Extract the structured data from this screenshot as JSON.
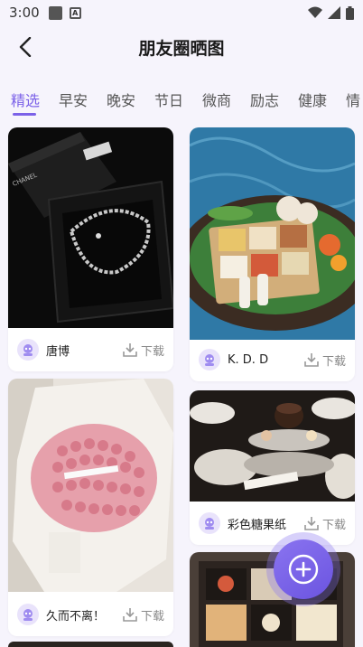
{
  "status": {
    "time": "3:00"
  },
  "header": {
    "title": "朋友圈晒图"
  },
  "tabs": [
    {
      "label": "精选",
      "active": true
    },
    {
      "label": "早安"
    },
    {
      "label": "晚安"
    },
    {
      "label": "节日"
    },
    {
      "label": "微商"
    },
    {
      "label": "励志"
    },
    {
      "label": "健康"
    },
    {
      "label": "情"
    }
  ],
  "cards": [
    {
      "user": "唐博",
      "download": "下载",
      "image": "chanel-bracelet-photo"
    },
    {
      "user": "K. D. D",
      "download": "下载",
      "image": "floating-breakfast-photo"
    },
    {
      "user": "久而不离！",
      "download": "下载",
      "image": "pink-rose-bouquet-photo"
    },
    {
      "user": "彩色糖果纸",
      "download": "下载",
      "image": "afternoon-tea-photo"
    },
    {
      "user": "",
      "download": "",
      "image": "bento-box-photo"
    }
  ],
  "colors": {
    "accent": "#7b61e8",
    "background": "#f6f4fc"
  },
  "icons": {
    "back": "chevron-left-icon",
    "download": "download-icon",
    "fab": "plus-icon"
  }
}
